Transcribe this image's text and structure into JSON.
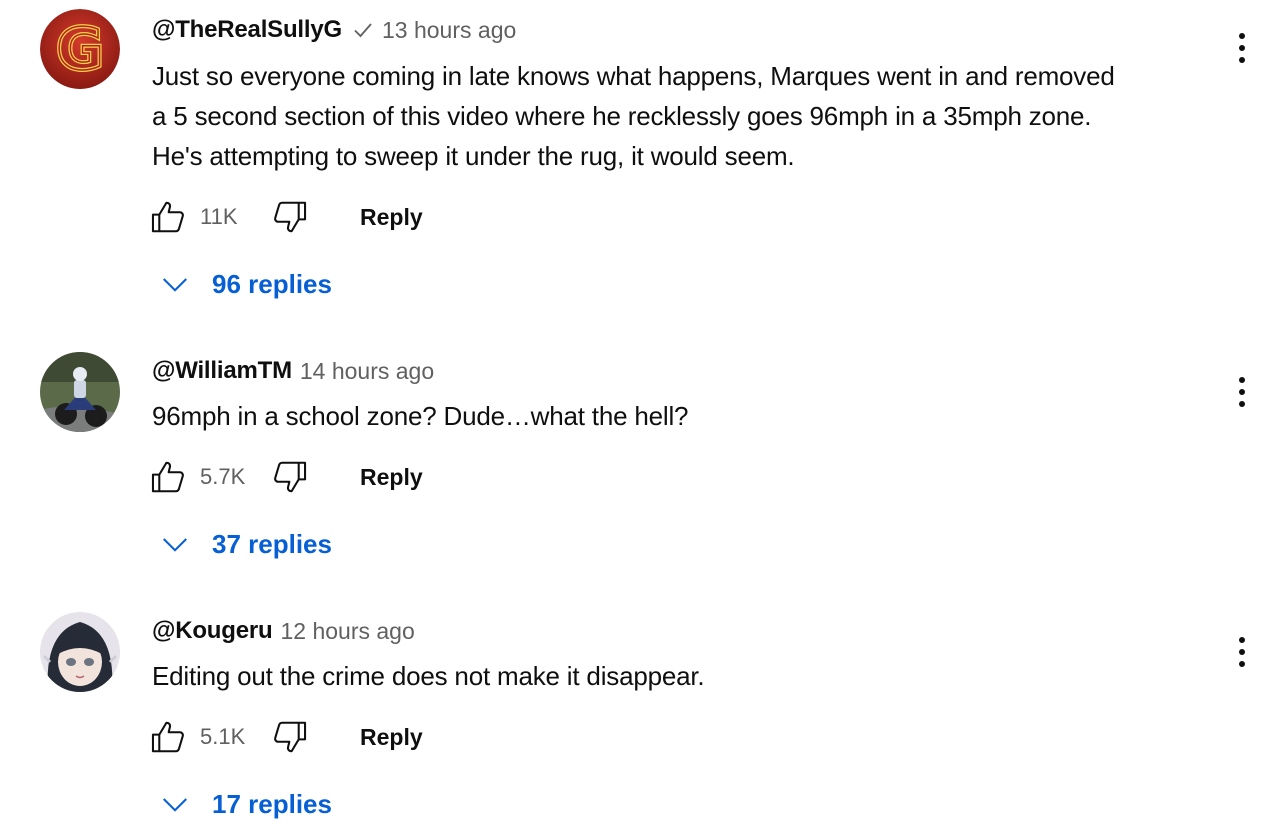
{
  "comments": [
    {
      "author": "@TheRealSullyG",
      "verified": true,
      "time": "13 hours ago",
      "text_lines": [
        "Just so everyone coming in late knows what happens, Marques went in and removed",
        "a 5 second section of this video where he recklessly goes 96mph in a 35mph zone.",
        "He's attempting to sweep it under the rug, it would seem."
      ],
      "likes": "11K",
      "reply_label": "Reply",
      "replies_label": "96 replies",
      "avatar_icon": "gold-letter-g-logo"
    },
    {
      "author": "@WilliamTM",
      "verified": false,
      "time": "14 hours ago",
      "text_lines": [
        "96mph in a school zone? Dude…what the hell?"
      ],
      "likes": "5.7K",
      "reply_label": "Reply",
      "replies_label": "37 replies",
      "avatar_icon": "motorcycle-rider-photo"
    },
    {
      "author": "@Kougeru",
      "verified": false,
      "time": "12 hours ago",
      "text_lines": [
        "Editing out the crime does not make it disappear."
      ],
      "likes": "5.1K",
      "reply_label": "Reply",
      "replies_label": "17 replies",
      "avatar_icon": "anime-girl-avatar"
    }
  ],
  "colors": {
    "author": "#0f0f0f",
    "meta": "#606060",
    "link_blue": "#065fd4"
  }
}
